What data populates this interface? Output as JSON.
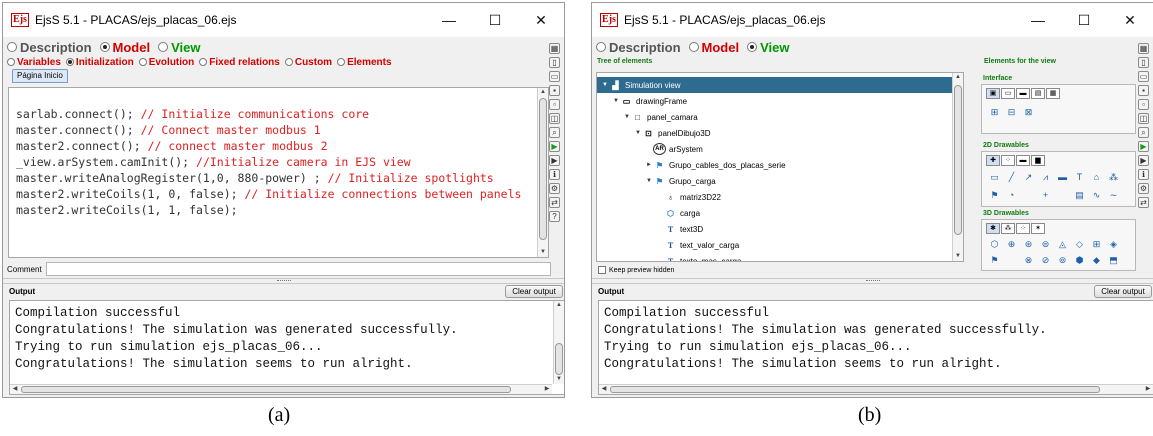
{
  "window": {
    "title": "EjsS 5.1 - PLACAS/ejs_placas_06.ejs",
    "app_icon": "Ejs",
    "minimize_glyph": "—",
    "maximize_glyph": "☐",
    "close_glyph": "✕"
  },
  "main_tabs": {
    "description": "Description",
    "model": "Model",
    "view": "View"
  },
  "model_subtabs": [
    "Variables",
    "Initialization",
    "Evolution",
    "Fixed relations",
    "Custom",
    "Elements"
  ],
  "page_tab": "Página Inicio",
  "code_lines": [
    {
      "code": "sarlab.connect(); ",
      "comment": "// Initialize communications core"
    },
    {
      "code": "master.connect(); ",
      "comment": "// Connect master modbus 1"
    },
    {
      "code": "master2.connect(); ",
      "comment": "// connect master modbus 2"
    },
    {
      "code": "_view.arSystem.camInit(); ",
      "comment": "//Initialize camera in EJS view"
    },
    {
      "code": "master.writeAnalogRegister(1,0, 880-power) ; ",
      "comment": "// Initialize spotlights"
    },
    {
      "code": "master2.writeCoils(1, 0, false); ",
      "comment": "// Initialize connections between panels"
    },
    {
      "code": "master2.writeCoils(1, 1, false);",
      "comment": ""
    }
  ],
  "comment_label": "Comment",
  "output_label": "Output",
  "clear_output": "Clear output",
  "output_lines": [
    "Compilation successful",
    "Congratulations! The simulation was generated successfully.",
    "Trying to run simulation ejs_placas_06...",
    "Congratulations! The simulation seems to run alright."
  ],
  "view_panel": {
    "tree_title": "Tree of elements",
    "elements_title": "Elements for the view",
    "keep_preview": "Keep preview hidden",
    "tree_items": [
      {
        "label": "Simulation view",
        "icon": "simulation-view-icon",
        "glyph": "▟",
        "arrow": "▼",
        "level": 0,
        "selected": true
      },
      {
        "label": "drawingFrame",
        "icon": "frame-icon",
        "glyph": "▭",
        "arrow": "▼",
        "level": 1
      },
      {
        "label": "panel_camara",
        "icon": "panel-icon",
        "glyph": "□",
        "arrow": "▼",
        "level": 2
      },
      {
        "label": "panelDibujo3D",
        "icon": "drawing-panel-3d-icon",
        "glyph": "⊡",
        "arrow": "▼",
        "level": 3
      },
      {
        "label": "arSystem",
        "icon": "ar-system-icon",
        "glyph": "AR",
        "arrow": "",
        "level": 4
      },
      {
        "label": "Grupo_cables_dos_placas_serie",
        "icon": "group-icon",
        "glyph": "⚑",
        "arrow": "►",
        "level": 4
      },
      {
        "label": "Grupo_carga",
        "icon": "group-icon",
        "glyph": "⚑",
        "arrow": "▼",
        "level": 4
      },
      {
        "label": "matriz3D22",
        "icon": "matrix-3d-icon",
        "glyph": "♁",
        "arrow": "",
        "level": 5
      },
      {
        "label": "carga",
        "icon": "cylinder-icon",
        "glyph": "⬡",
        "arrow": "",
        "level": 5
      },
      {
        "label": "text3D",
        "icon": "text-icon",
        "glyph": "T",
        "arrow": "",
        "level": 5
      },
      {
        "label": "text_valor_carga",
        "icon": "text-icon",
        "glyph": "T",
        "arrow": "",
        "level": 5
      },
      {
        "label": "texto_mas_carga",
        "icon": "text-icon",
        "glyph": "T",
        "arrow": "",
        "level": 5
      }
    ],
    "palette": {
      "interface_title": "Interface",
      "drawables2d_title": "2D Drawables",
      "drawables3d_title": "3D Drawables",
      "interface_rows": [
        [
          "⊞",
          "⊟",
          "⊠"
        ]
      ],
      "d2_rows": [
        [
          "▭",
          "╱",
          "↗",
          "⩘",
          "▬",
          "T",
          "⌂",
          "⁂"
        ],
        [
          "⚑",
          "◔",
          "",
          "+",
          "",
          "▤",
          "∿",
          "∼"
        ]
      ],
      "d3_rows": [
        [
          "⬡",
          "⊕",
          "⊛",
          "⊜",
          "◬",
          "◇",
          "⊞",
          "◈"
        ],
        [
          "⚑",
          "",
          "⊗",
          "⊘",
          "⊚",
          "⬢",
          "◆",
          "⬒"
        ]
      ]
    }
  },
  "captions": {
    "left": "(a)",
    "right": "(b)"
  }
}
